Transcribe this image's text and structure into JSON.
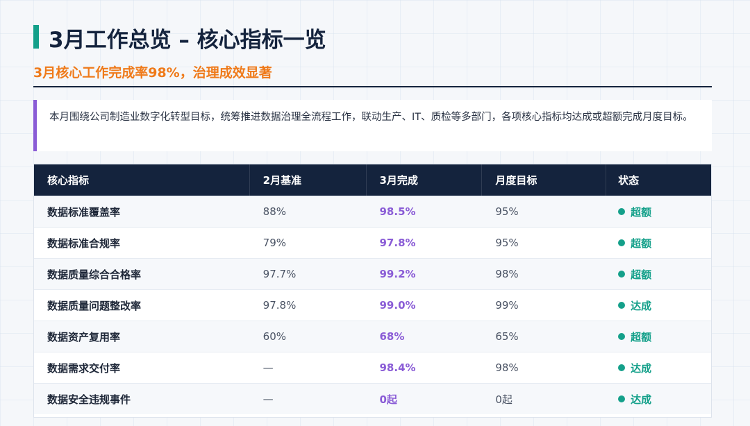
{
  "header": {
    "title": "3月工作总览 – 核心指标一览",
    "subtitle": "3月核心工作完成率98%，治理成效显著"
  },
  "intro": "本月围绕公司制造业数字化转型目标，统筹推进数据治理全流程工作，联动生产、IT、质检等多部门，各项核心指标均达成或超额完成月度目标。",
  "table": {
    "headers": [
      "核心指标",
      "2月基准",
      "3月完成",
      "月度目标",
      "状态"
    ],
    "rows": [
      {
        "metric": "数据标准覆盖率",
        "feb": "88%",
        "march": "98.5%",
        "target": "95%",
        "status": "超额"
      },
      {
        "metric": "数据标准合规率",
        "feb": "79%",
        "march": "97.8%",
        "target": "95%",
        "status": "超额"
      },
      {
        "metric": "数据质量综合合格率",
        "feb": "97.7%",
        "march": "99.2%",
        "target": "98%",
        "status": "超额"
      },
      {
        "metric": "数据质量问题整改率",
        "feb": "97.8%",
        "march": "99.0%",
        "target": "99%",
        "status": "达成"
      },
      {
        "metric": "数据资产复用率",
        "feb": "60%",
        "march": "68%",
        "target": "65%",
        "status": "超额"
      },
      {
        "metric": "数据需求交付率",
        "feb": "—",
        "march": "98.4%",
        "target": "98%",
        "status": "达成"
      },
      {
        "metric": "数据安全违规事件",
        "feb": "—",
        "march": "0起",
        "target": "0起",
        "status": "达成"
      }
    ]
  },
  "colors": {
    "navy": "#14233d",
    "teal": "#14a08a",
    "orange": "#ef7a1a",
    "purple": "#8a5cd6"
  }
}
